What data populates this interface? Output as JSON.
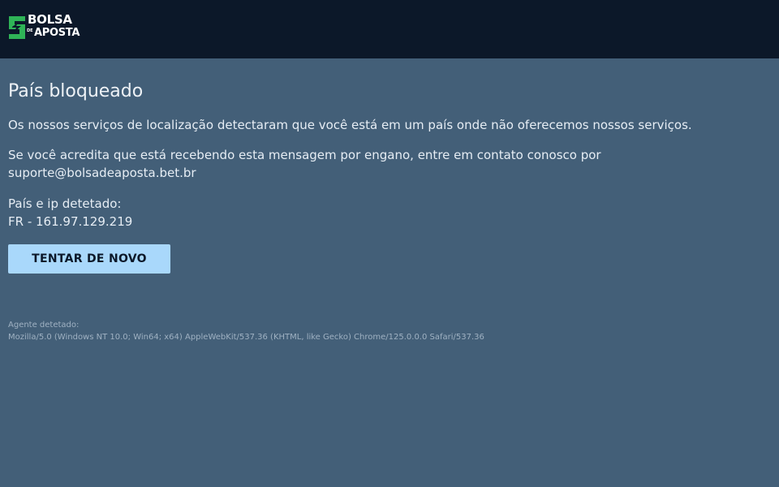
{
  "header": {
    "logo": {
      "line1": "BOLSA",
      "de": "DE",
      "line2": "APOSTA",
      "icon": "bolsa-s-logo-icon"
    }
  },
  "colors": {
    "header_bg": "#0c1829",
    "page_bg": "#435f78",
    "logo_green": "#2fb457",
    "button_bg": "#a9d8fb"
  },
  "main": {
    "title": "País bloqueado",
    "message": "Os nossos serviços de localização detectaram que você está em um país onde não oferecemos nossos serviços.",
    "contact_line1": "Se você acredita que está recebendo esta mensagem por engano, entre em contato conosco por",
    "contact_line2": "suporte@bolsadeaposta.bet.br",
    "detected_label": "País e ip detetado:",
    "detected_value": "FR - 161.97.129.219",
    "retry_button": "TENTAR DE NOVO",
    "agent_label": "Agente detetado:",
    "agent_value": "Mozilla/5.0 (Windows NT 10.0; Win64; x64) AppleWebKit/537.36 (KHTML, like Gecko) Chrome/125.0.0.0 Safari/537.36"
  }
}
